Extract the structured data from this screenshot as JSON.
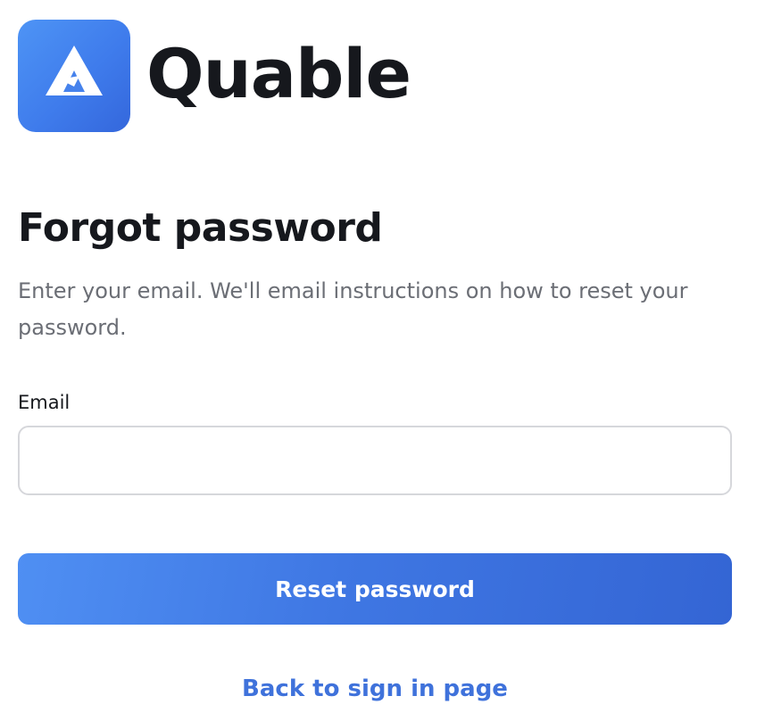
{
  "brand": {
    "name": "Quable",
    "logo_icon": "quable-triangle-logo-icon",
    "logo_color": "#4a86ee"
  },
  "page": {
    "title": "Forgot password",
    "subtitle": "Enter your email. We'll email instructions on how to reset your password."
  },
  "form": {
    "email_label": "Email",
    "email_value": "",
    "email_placeholder": "",
    "submit_label": "Reset password"
  },
  "links": {
    "back_label": "Back to sign in page"
  },
  "colors": {
    "accent": "#3f72db",
    "button": "#3f77e3",
    "text": "#16181d",
    "muted": "#6b6e75"
  }
}
